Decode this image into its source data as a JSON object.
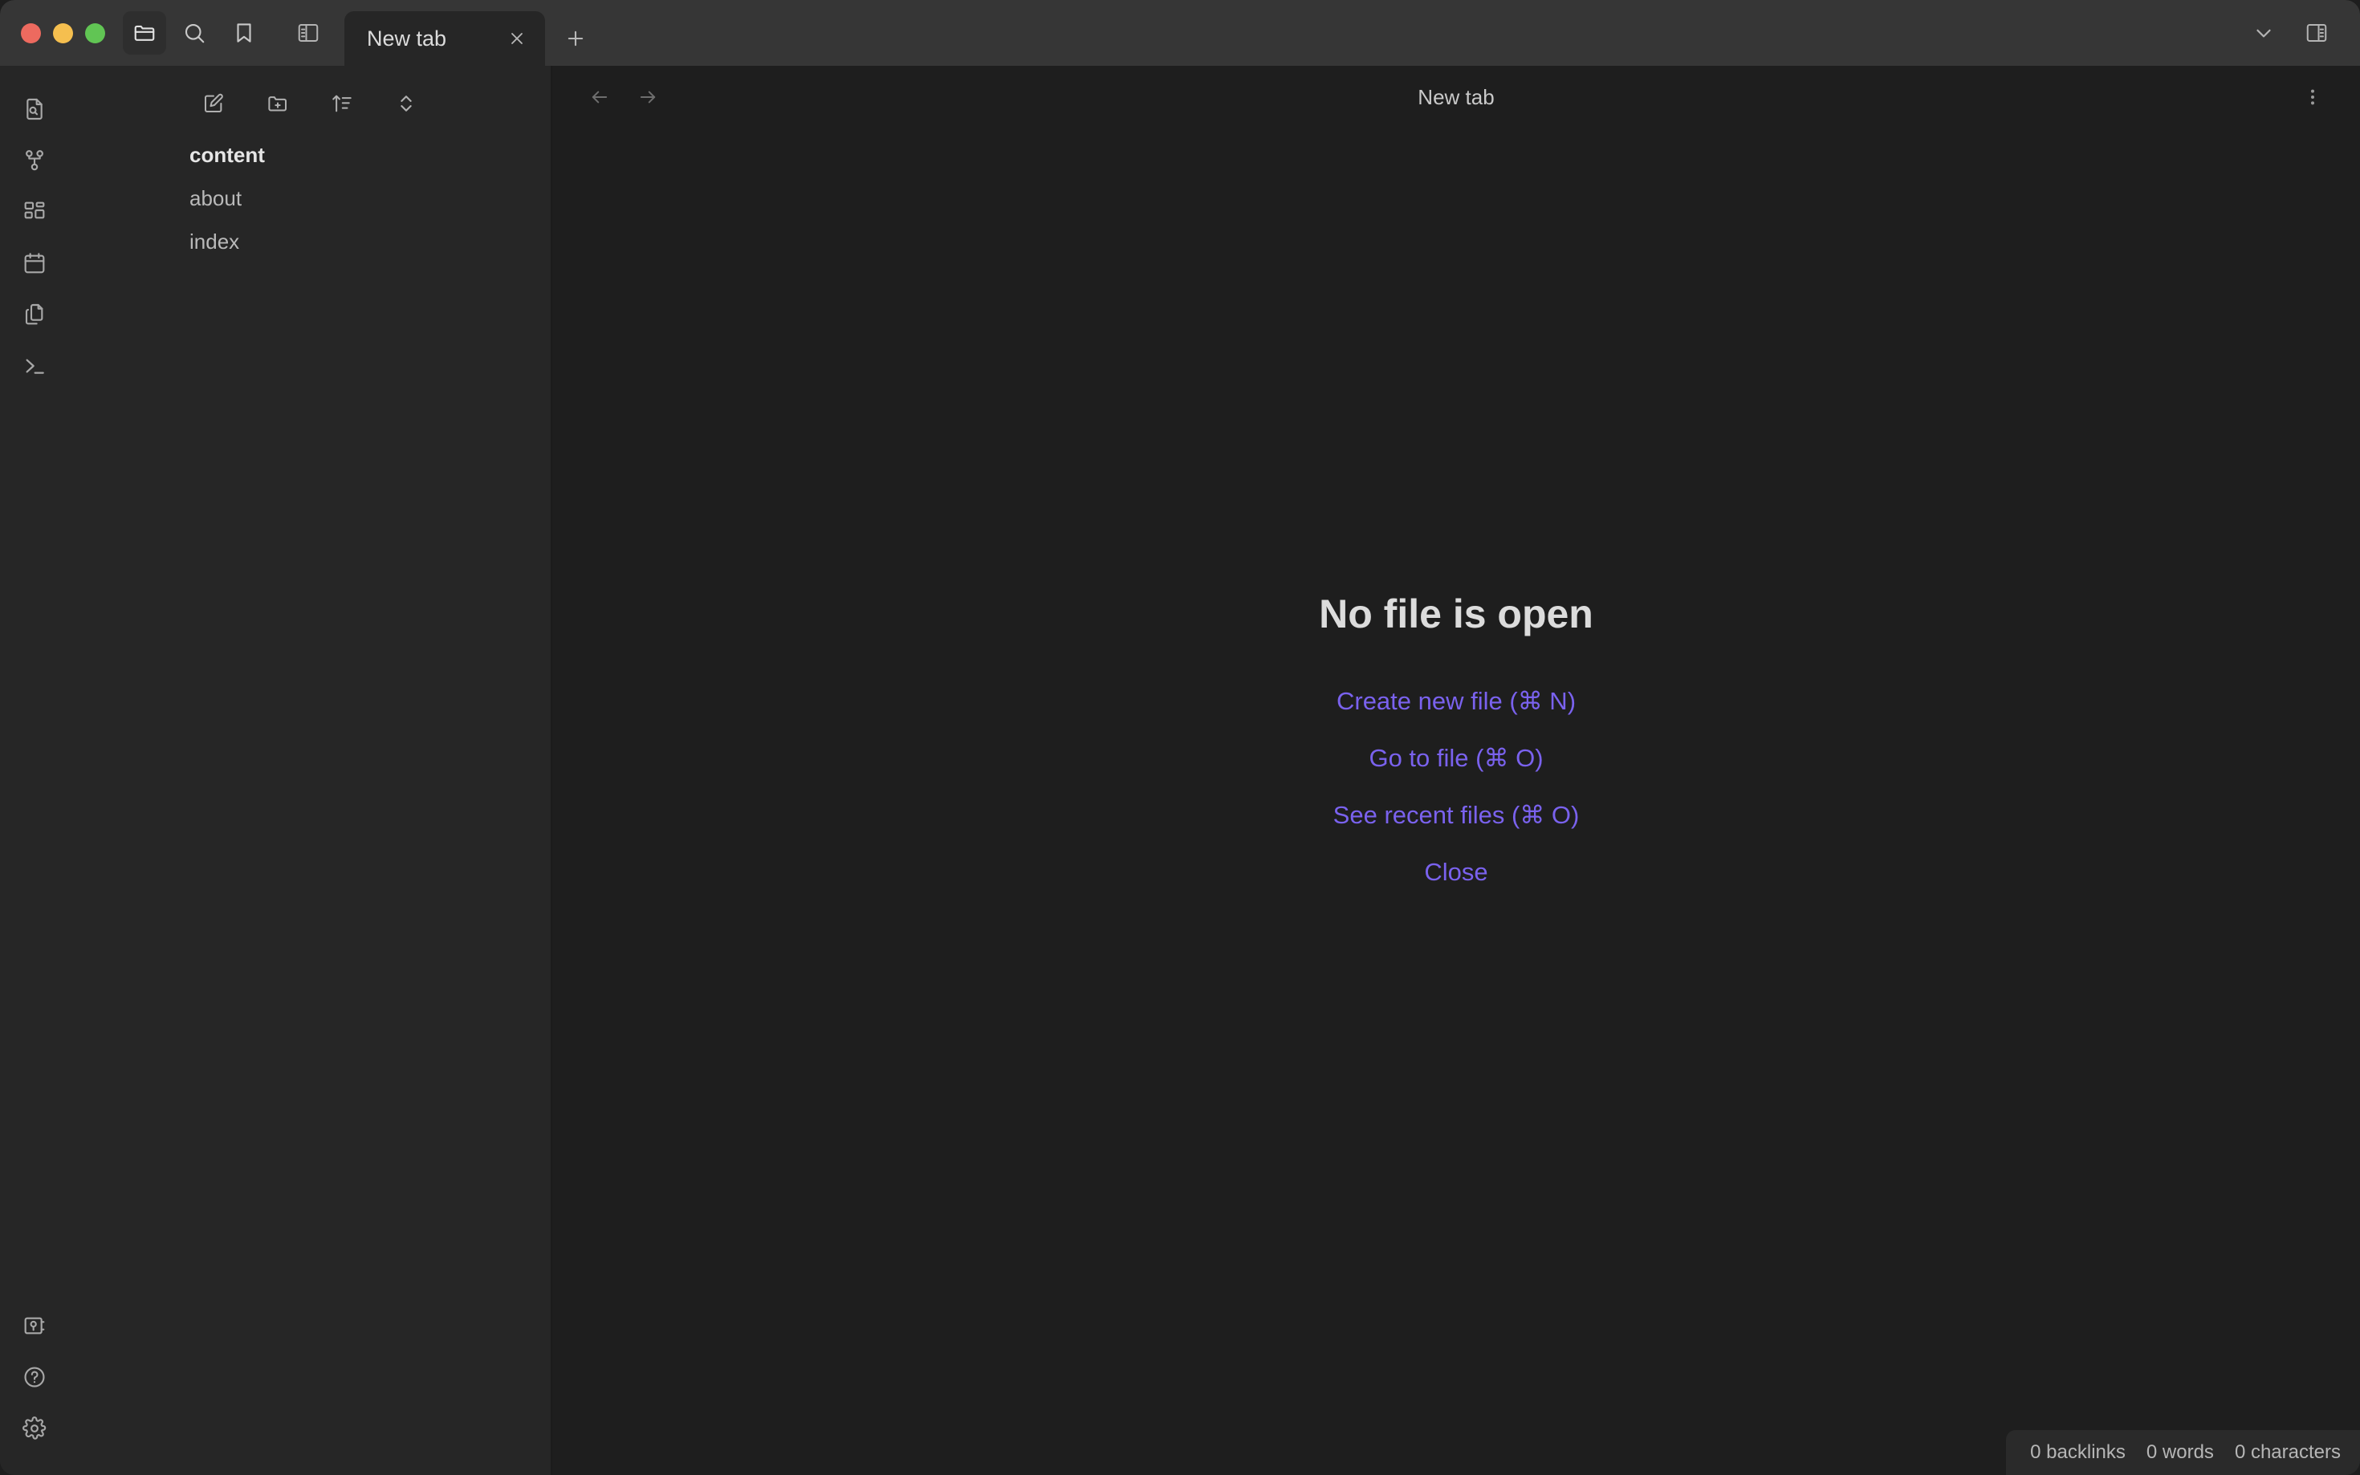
{
  "titlebar": {
    "traffic_lights": [
      {
        "name": "close",
        "color": "#ed6a5f"
      },
      {
        "name": "minimize",
        "color": "#f5bf4f"
      },
      {
        "name": "maximize",
        "color": "#61c554"
      }
    ],
    "left_buttons": [
      {
        "icon": "folder-icon",
        "label": "Open folder",
        "active": true
      },
      {
        "icon": "search-icon",
        "label": "Search",
        "active": false
      },
      {
        "icon": "bookmark-icon",
        "label": "Bookmarks",
        "active": false
      }
    ],
    "toggle_left_sidebar": {
      "icon": "left-sidebar-toggle-icon",
      "label": "Toggle left sidebar"
    },
    "right_buttons": [
      {
        "icon": "chevron-down-icon",
        "label": "Tab list"
      },
      {
        "icon": "right-sidebar-toggle-icon",
        "label": "Toggle right sidebar"
      }
    ]
  },
  "tabs": {
    "items": [
      {
        "title": "New tab",
        "active": true,
        "close_label": "Close tab"
      }
    ],
    "new_tab_label": "New tab"
  },
  "rail": {
    "top_items": [
      {
        "icon": "file-search-icon",
        "label": "Search in file"
      },
      {
        "icon": "graph-view-icon",
        "label": "Graph view"
      },
      {
        "icon": "canvas-grid-icon",
        "label": "Canvas"
      },
      {
        "icon": "calendar-icon",
        "label": "Daily notes"
      },
      {
        "icon": "copy-files-icon",
        "label": "Templates"
      },
      {
        "icon": "terminal-icon",
        "label": "Command palette"
      }
    ],
    "bottom_items": [
      {
        "icon": "vault-icon",
        "label": "Open another vault"
      },
      {
        "icon": "help-icon",
        "label": "Help"
      },
      {
        "icon": "settings-gear-icon",
        "label": "Settings"
      }
    ]
  },
  "explorer": {
    "toolbar": [
      {
        "icon": "new-note-icon",
        "label": "New note"
      },
      {
        "icon": "new-folder-icon",
        "label": "New folder"
      },
      {
        "icon": "sort-icon",
        "label": "Change sort order"
      },
      {
        "icon": "collapse-expand-icon",
        "label": "Expand all"
      }
    ],
    "files": [
      {
        "name": "content",
        "type": "folder"
      },
      {
        "name": "about",
        "type": "file"
      },
      {
        "name": "index",
        "type": "file"
      }
    ]
  },
  "view": {
    "back_label": "Navigate back",
    "forward_label": "Navigate forward",
    "title": "New tab",
    "menu_label": "More options"
  },
  "empty_state": {
    "title": "No file is open",
    "actions": [
      "Create new file (⌘ N)",
      "Go to file (⌘ O)",
      "See recent files (⌘ O)",
      "Close"
    ],
    "link_color": "#7a62ee"
  },
  "statusbar": {
    "items": [
      "0 backlinks",
      "0 words",
      "0 characters"
    ]
  },
  "theme": {
    "titlebar_bg": "#363636",
    "sidebar_bg": "#262626",
    "main_bg": "#1e1e1e",
    "statusbar_bg": "#2a2a2a",
    "text": "#dcdcdc",
    "muted_text": "#b0b0b0"
  }
}
